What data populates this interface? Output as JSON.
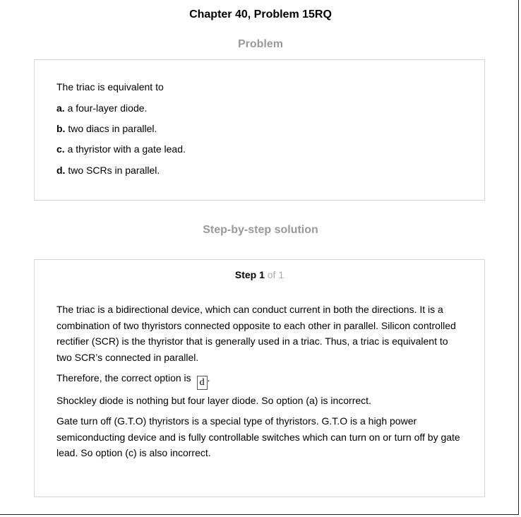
{
  "header": {
    "chapter_title": "Chapter 40, Problem 15RQ",
    "problem_heading": "Problem",
    "solution_heading": "Step-by-step solution"
  },
  "problem": {
    "question": "The triac is equivalent to",
    "options": [
      {
        "letter": "a.",
        "text": "a four-layer diode."
      },
      {
        "letter": "b.",
        "text": "two diacs in parallel."
      },
      {
        "letter": "c.",
        "text": "a thyristor with a gate lead."
      },
      {
        "letter": "d.",
        "text": "two SCRs in parallel."
      }
    ]
  },
  "solution": {
    "step_word": "Step 1",
    "step_of": "of 1",
    "paragraph1": "The triac is a bidirectional device, which can conduct current in both the directions. It is a combination of two thyristors connected opposite to each other in parallel. Silicon controlled rectifier (SCR) is the thyristor that is generally used in a triac. Thus, a triac is equivalent to two SCR’s connected in parallel.",
    "answer_prefix": "Therefore, the correct option is",
    "answer_value": "d",
    "answer_suffix": ".",
    "paragraph2": "Shockley diode is nothing but four layer diode. So option (a) is incorrect.",
    "paragraph3": "Gate turn off (G.T.O) thyristors is a special type of thyristors. G.T.O is a high power semiconducting device and is fully controllable switches which can turn on or turn off by gate lead. So option (c) is also incorrect."
  }
}
